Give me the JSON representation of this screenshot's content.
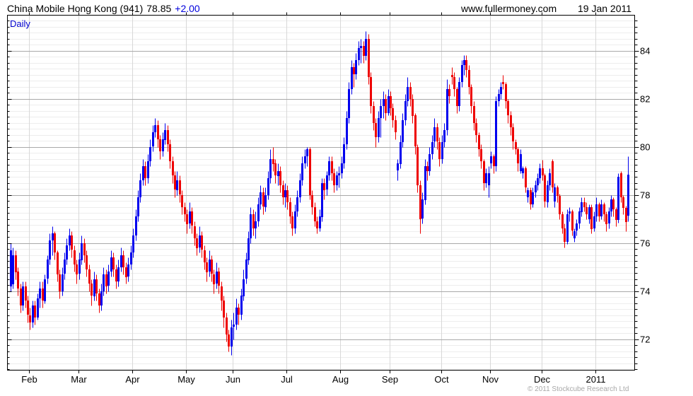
{
  "header": {
    "instrument": "China Mobile Hong Kong (941)",
    "price": "78.85",
    "change": "+2.00",
    "site": "www.fullermoney.com",
    "date": "19 Jan 2011"
  },
  "chart": {
    "interval_label": "Daily",
    "copyright": "© 2011 Stockcube Research Ltd",
    "colors": {
      "up": "#0000ee",
      "down": "#ee0000",
      "grid_minor": "#ededed",
      "grid_month": "#d8d8d8",
      "grid_major": "#a9a9a9",
      "border": "#000000",
      "accent_text": "#0000cc"
    }
  },
  "chart_data": {
    "type": "candlestick",
    "title": "China Mobile Hong Kong (941) Daily",
    "interval": "Daily",
    "last_price": 78.85,
    "change": 2.0,
    "ylim": [
      70.7,
      85.5
    ],
    "y_major_ticks": [
      72,
      74,
      76,
      78,
      80,
      82,
      84
    ],
    "y_minor_step": 0.25,
    "grid": true,
    "legend_position": "none",
    "x_ticks": [
      {
        "label": "Feb",
        "day": 8
      },
      {
        "label": "Mar",
        "day": 28
      },
      {
        "label": "Apr",
        "day": 50
      },
      {
        "label": "May",
        "day": 72
      },
      {
        "label": "Jun",
        "day": 91
      },
      {
        "label": "Jul",
        "day": 113
      },
      {
        "label": "Aug",
        "day": 135
      },
      {
        "label": "Sep",
        "day": 155
      },
      {
        "label": "Oct",
        "day": 176
      },
      {
        "label": "Nov",
        "day": 196
      },
      {
        "label": "Dec",
        "day": 217
      },
      {
        "label": "2011",
        "day": 239
      }
    ],
    "ohlc": [
      [
        74.2,
        76.0,
        74.0,
        75.7
      ],
      [
        74.3,
        75.8,
        74.1,
        75.5
      ],
      [
        75.5,
        75.7,
        74.5,
        74.8
      ],
      [
        74.8,
        75.0,
        73.8,
        74.1
      ],
      [
        74.1,
        74.3,
        73.1,
        73.4
      ],
      [
        73.4,
        74.4,
        73.2,
        74.2
      ],
      [
        74.2,
        74.4,
        73.3,
        73.6
      ],
      [
        73.6,
        73.8,
        72.7,
        73.0
      ],
      [
        73.0,
        73.3,
        72.4,
        72.7
      ],
      [
        72.7,
        73.6,
        72.5,
        73.4
      ],
      [
        73.4,
        73.6,
        72.6,
        72.9
      ],
      [
        72.9,
        73.9,
        72.8,
        73.7
      ],
      [
        73.7,
        74.4,
        73.3,
        74.1
      ],
      [
        74.1,
        74.4,
        73.3,
        73.6
      ],
      [
        73.6,
        74.7,
        73.5,
        74.5
      ],
      [
        74.5,
        75.5,
        74.3,
        75.3
      ],
      [
        75.3,
        76.4,
        75.1,
        76.1
      ],
      [
        76.1,
        76.7,
        75.5,
        76.4
      ],
      [
        76.4,
        76.5,
        75.3,
        75.6
      ],
      [
        75.6,
        75.7,
        74.4,
        74.7
      ],
      [
        74.7,
        74.9,
        73.7,
        74.0
      ],
      [
        74.0,
        75.0,
        73.8,
        74.7
      ],
      [
        74.7,
        75.6,
        74.5,
        75.3
      ],
      [
        75.3,
        76.2,
        75.1,
        75.9
      ],
      [
        75.9,
        76.6,
        75.7,
        76.3
      ],
      [
        76.3,
        76.5,
        75.4,
        75.7
      ],
      [
        75.7,
        75.9,
        74.8,
        75.1
      ],
      [
        75.1,
        75.3,
        74.3,
        74.7
      ],
      [
        74.7,
        75.6,
        74.5,
        75.3
      ],
      [
        75.3,
        76.3,
        75.1,
        76.0
      ],
      [
        76.0,
        76.2,
        75.2,
        75.5
      ],
      [
        75.5,
        75.7,
        74.6,
        74.9
      ],
      [
        74.9,
        75.1,
        74.0,
        74.3
      ],
      [
        74.3,
        74.5,
        73.4,
        73.8
      ],
      [
        73.8,
        74.8,
        73.6,
        74.5
      ],
      [
        74.5,
        74.7,
        73.6,
        73.9
      ],
      [
        73.9,
        74.1,
        73.1,
        73.4
      ],
      [
        73.4,
        74.3,
        73.2,
        74.0
      ],
      [
        74.0,
        75.0,
        73.8,
        74.7
      ],
      [
        74.7,
        74.9,
        73.9,
        74.2
      ],
      [
        74.2,
        75.1,
        74.0,
        74.8
      ],
      [
        74.8,
        75.7,
        74.6,
        75.4
      ],
      [
        75.4,
        75.6,
        74.6,
        74.9
      ],
      [
        74.9,
        75.1,
        74.1,
        74.4
      ],
      [
        74.4,
        75.3,
        74.2,
        75.0
      ],
      [
        75.0,
        75.8,
        74.8,
        75.5
      ],
      [
        75.5,
        75.7,
        74.7,
        75.0
      ],
      [
        75.0,
        75.2,
        74.3,
        74.6
      ],
      [
        74.6,
        75.4,
        74.4,
        75.1
      ],
      [
        75.1,
        75.9,
        74.9,
        75.6
      ],
      [
        75.6,
        76.6,
        75.4,
        76.3
      ],
      [
        76.3,
        77.4,
        76.1,
        77.1
      ],
      [
        77.1,
        78.2,
        76.9,
        77.9
      ],
      [
        77.9,
        78.9,
        77.7,
        78.6
      ],
      [
        78.6,
        79.5,
        78.4,
        79.2
      ],
      [
        79.2,
        79.4,
        78.4,
        78.7
      ],
      [
        78.7,
        79.7,
        78.5,
        79.4
      ],
      [
        79.4,
        80.3,
        79.2,
        80.0
      ],
      [
        80.0,
        80.9,
        79.8,
        80.6
      ],
      [
        80.6,
        81.2,
        80.4,
        80.9
      ],
      [
        80.9,
        81.1,
        80.0,
        80.3
      ],
      [
        80.3,
        80.5,
        79.5,
        79.8
      ],
      [
        79.8,
        80.6,
        79.6,
        80.3
      ],
      [
        80.3,
        81.0,
        80.1,
        80.7
      ],
      [
        80.7,
        80.9,
        79.8,
        80.1
      ],
      [
        80.1,
        80.3,
        79.1,
        79.4
      ],
      [
        79.4,
        79.6,
        78.5,
        78.8
      ],
      [
        78.8,
        79.0,
        77.9,
        78.2
      ],
      [
        78.2,
        79.0,
        78.0,
        78.6
      ],
      [
        78.6,
        78.8,
        77.7,
        78.0
      ],
      [
        78.0,
        78.2,
        77.2,
        77.5
      ],
      [
        77.5,
        77.7,
        76.9,
        77.2
      ],
      [
        77.2,
        77.4,
        76.4,
        76.8
      ],
      [
        76.8,
        77.7,
        76.6,
        77.3
      ],
      [
        77.3,
        77.5,
        76.4,
        76.7
      ],
      [
        76.7,
        76.9,
        75.9,
        76.2
      ],
      [
        76.2,
        76.4,
        75.5,
        75.8
      ],
      [
        75.8,
        76.7,
        75.6,
        76.3
      ],
      [
        76.3,
        76.5,
        75.4,
        75.7
      ],
      [
        75.7,
        75.9,
        74.9,
        75.2
      ],
      [
        75.2,
        75.4,
        74.4,
        74.8
      ],
      [
        74.8,
        75.7,
        74.6,
        75.3
      ],
      [
        75.3,
        75.5,
        74.4,
        74.7
      ],
      [
        74.7,
        74.9,
        73.9,
        74.3
      ],
      [
        74.3,
        75.2,
        74.1,
        74.8
      ],
      [
        74.8,
        75.0,
        73.9,
        74.2
      ],
      [
        74.2,
        74.4,
        73.2,
        73.6
      ],
      [
        73.6,
        73.8,
        72.5,
        72.9
      ],
      [
        72.9,
        73.1,
        71.9,
        72.2
      ],
      [
        72.2,
        72.4,
        71.5,
        71.7
      ],
      [
        71.7,
        72.8,
        71.35,
        72.5
      ],
      [
        72.5,
        73.1,
        72.0,
        72.6
      ],
      [
        72.6,
        73.7,
        72.4,
        73.3
      ],
      [
        73.3,
        73.5,
        72.6,
        73.0
      ],
      [
        73.0,
        74.1,
        72.8,
        73.8
      ],
      [
        73.8,
        74.9,
        73.6,
        74.5
      ],
      [
        74.5,
        75.6,
        74.3,
        75.3
      ],
      [
        75.3,
        76.5,
        75.1,
        76.2
      ],
      [
        76.2,
        77.5,
        76.0,
        77.2
      ],
      [
        77.2,
        77.4,
        76.3,
        76.6
      ],
      [
        76.6,
        77.3,
        76.2,
        76.9
      ],
      [
        76.9,
        77.9,
        76.7,
        77.6
      ],
      [
        77.6,
        78.4,
        77.4,
        78.1
      ],
      [
        78.1,
        78.3,
        77.2,
        77.5
      ],
      [
        77.5,
        78.3,
        77.3,
        78.0
      ],
      [
        78.0,
        79.0,
        77.8,
        78.7
      ],
      [
        78.7,
        79.9,
        78.5,
        79.5
      ],
      [
        79.5,
        80.0,
        79.0,
        79.3
      ],
      [
        79.3,
        79.5,
        78.5,
        78.8
      ],
      [
        78.8,
        79.3,
        78.4,
        79.0
      ],
      [
        79.0,
        79.2,
        78.1,
        78.4
      ],
      [
        78.4,
        78.6,
        77.6,
        77.9
      ],
      [
        77.9,
        78.5,
        77.5,
        78.2
      ],
      [
        78.2,
        78.4,
        77.4,
        77.7
      ],
      [
        77.7,
        77.9,
        76.8,
        77.1
      ],
      [
        77.1,
        77.3,
        76.3,
        76.6
      ],
      [
        76.6,
        77.6,
        76.4,
        77.3
      ],
      [
        77.3,
        78.2,
        77.1,
        77.9
      ],
      [
        77.9,
        78.9,
        77.7,
        78.6
      ],
      [
        78.6,
        79.6,
        78.4,
        79.3
      ],
      [
        79.3,
        79.9,
        79.1,
        79.6
      ],
      [
        79.6,
        80.0,
        79.2,
        79.9
      ],
      [
        79.9,
        80.0,
        77.8,
        78.0
      ],
      [
        78.0,
        78.2,
        77.2,
        77.5
      ],
      [
        77.5,
        77.7,
        76.7,
        76.9
      ],
      [
        76.9,
        77.1,
        76.4,
        76.6
      ],
      [
        76.6,
        77.4,
        76.5,
        77.1
      ],
      [
        77.1,
        78.7,
        76.9,
        78.5
      ],
      [
        78.5,
        78.7,
        77.8,
        78.2
      ],
      [
        78.2,
        79.0,
        78.0,
        78.8
      ],
      [
        78.8,
        79.6,
        78.6,
        79.4
      ],
      [
        79.4,
        79.6,
        78.6,
        78.9
      ],
      [
        78.9,
        79.1,
        78.1,
        78.4
      ],
      [
        78.4,
        79.0,
        78.2,
        78.8
      ],
      [
        78.8,
        79.2,
        78.3,
        78.9
      ],
      [
        78.9,
        79.6,
        78.7,
        79.3
      ],
      [
        79.3,
        80.4,
        79.1,
        80.1
      ],
      [
        80.1,
        81.5,
        79.9,
        81.2
      ],
      [
        81.2,
        82.7,
        81.0,
        82.4
      ],
      [
        82.4,
        83.6,
        82.2,
        83.3
      ],
      [
        83.3,
        83.5,
        82.5,
        83.0
      ],
      [
        83.0,
        83.9,
        82.8,
        83.6
      ],
      [
        83.6,
        84.4,
        83.4,
        84.1
      ],
      [
        84.1,
        84.5,
        83.5,
        84.2
      ],
      [
        84.2,
        84.4,
        83.5,
        83.8
      ],
      [
        83.8,
        84.8,
        83.6,
        84.5
      ],
      [
        84.5,
        84.7,
        82.6,
        82.9
      ],
      [
        82.9,
        83.1,
        81.4,
        81.7
      ],
      [
        81.7,
        81.9,
        80.7,
        81.0
      ],
      [
        81.0,
        81.2,
        80.0,
        80.4
      ],
      [
        80.4,
        81.5,
        80.2,
        81.2
      ],
      [
        81.2,
        82.0,
        80.4,
        81.7
      ],
      [
        81.7,
        82.3,
        81.2,
        82.0
      ],
      [
        82.0,
        82.2,
        81.1,
        81.4
      ],
      [
        81.4,
        82.4,
        81.3,
        82.1
      ],
      [
        82.1,
        82.3,
        81.3,
        81.6
      ],
      [
        81.6,
        81.8,
        80.8,
        81.1
      ],
      [
        81.1,
        81.3,
        80.3,
        80.6
      ],
      [
        79.0,
        79.5,
        78.6,
        79.3
      ],
      [
        79.3,
        80.5,
        79.1,
        80.2
      ],
      [
        80.2,
        81.4,
        80.0,
        81.1
      ],
      [
        81.1,
        82.2,
        80.9,
        81.9
      ],
      [
        81.9,
        82.9,
        81.7,
        82.5
      ],
      [
        82.5,
        82.7,
        81.7,
        82.0
      ],
      [
        82.0,
        82.2,
        81.0,
        81.3
      ],
      [
        81.3,
        81.4,
        79.7,
        80.0
      ],
      [
        80.0,
        80.1,
        78.1,
        78.4
      ],
      [
        78.4,
        78.6,
        76.4,
        77.0
      ],
      [
        77.0,
        78.1,
        76.8,
        77.8
      ],
      [
        77.8,
        79.5,
        77.6,
        79.2
      ],
      [
        79.2,
        79.4,
        78.6,
        79.0
      ],
      [
        79.0,
        80.0,
        78.8,
        79.7
      ],
      [
        79.7,
        80.5,
        79.5,
        80.2
      ],
      [
        80.2,
        81.2,
        80.0,
        80.8
      ],
      [
        80.8,
        81.0,
        79.9,
        80.2
      ],
      [
        80.2,
        80.4,
        79.2,
        79.5
      ],
      [
        79.5,
        80.5,
        79.3,
        80.2
      ],
      [
        80.2,
        81.0,
        80.0,
        80.7
      ],
      [
        80.7,
        82.8,
        80.5,
        82.4
      ],
      [
        82.4,
        82.6,
        81.8,
        82.1
      ],
      [
        83.0,
        83.3,
        82.6,
        82.9
      ],
      [
        82.9,
        83.1,
        82.1,
        82.4
      ],
      [
        82.4,
        82.5,
        81.4,
        81.7
      ],
      [
        81.7,
        82.9,
        81.5,
        82.7
      ],
      [
        82.7,
        83.6,
        82.5,
        83.4
      ],
      [
        83.4,
        83.8,
        83.0,
        83.6
      ],
      [
        83.6,
        83.8,
        82.9,
        83.2
      ],
      [
        83.2,
        83.4,
        82.2,
        82.5
      ],
      [
        82.5,
        82.6,
        81.4,
        81.7
      ],
      [
        81.7,
        81.9,
        80.7,
        81.0
      ],
      [
        81.0,
        81.2,
        80.2,
        80.5
      ],
      [
        80.5,
        80.6,
        79.6,
        79.9
      ],
      [
        79.9,
        80.1,
        79.1,
        79.4
      ],
      [
        79.4,
        79.5,
        78.2,
        78.5
      ],
      [
        78.5,
        79.1,
        78.3,
        78.9
      ],
      [
        78.4,
        79.2,
        77.9,
        78.9
      ],
      [
        79.3,
        79.8,
        79.1,
        79.6
      ],
      [
        79.6,
        79.7,
        78.9,
        79.2
      ],
      [
        79.2,
        82.1,
        79.0,
        81.9
      ],
      [
        81.9,
        82.4,
        81.7,
        82.2
      ],
      [
        82.2,
        82.7,
        82.0,
        82.5
      ],
      [
        82.7,
        83.0,
        82.4,
        82.6
      ],
      [
        82.6,
        82.7,
        81.6,
        81.9
      ],
      [
        81.9,
        82.0,
        81.0,
        81.3
      ],
      [
        81.3,
        81.5,
        80.5,
        80.8
      ],
      [
        80.8,
        81.0,
        79.9,
        80.2
      ],
      [
        80.2,
        80.3,
        79.7,
        79.9
      ],
      [
        79.9,
        80.0,
        79.0,
        79.3
      ],
      [
        79.0,
        79.9,
        78.9,
        79.7
      ],
      [
        78.9,
        79.2,
        78.7,
        79.1
      ],
      [
        79.1,
        79.2,
        78.1,
        78.3
      ],
      [
        77.9,
        78.3,
        77.7,
        78.2
      ],
      [
        78.2,
        78.3,
        77.4,
        77.6
      ],
      [
        77.6,
        78.3,
        77.5,
        78.1
      ],
      [
        78.1,
        78.6,
        77.9,
        78.4
      ],
      [
        78.4,
        78.9,
        78.2,
        78.7
      ],
      [
        78.7,
        79.3,
        78.5,
        79.1
      ],
      [
        79.1,
        79.45,
        78.6,
        78.8
      ],
      [
        78.8,
        78.9,
        77.5,
        77.7
      ],
      [
        77.7,
        78.6,
        77.5,
        78.4
      ],
      [
        78.4,
        79.1,
        78.2,
        78.9
      ],
      [
        79.4,
        79.5,
        78.1,
        78.3
      ],
      [
        77.7,
        78.5,
        77.5,
        78.3
      ],
      [
        78.3,
        78.4,
        77.7,
        77.95
      ],
      [
        77.95,
        78.05,
        77.0,
        77.2
      ],
      [
        77.2,
        77.3,
        76.4,
        76.6
      ],
      [
        76.6,
        76.8,
        75.8,
        76.05
      ],
      [
        76.05,
        77.4,
        75.95,
        77.2
      ],
      [
        77.2,
        77.5,
        76.9,
        77.3
      ],
      [
        77.3,
        77.4,
        76.3,
        76.5
      ],
      [
        76.2,
        76.6,
        76.05,
        76.5
      ],
      [
        76.5,
        77.0,
        76.3,
        76.8
      ],
      [
        76.8,
        77.5,
        76.6,
        77.3
      ],
      [
        77.3,
        77.9,
        77.1,
        77.7
      ],
      [
        77.7,
        77.9,
        77.3,
        77.5
      ],
      [
        77.5,
        77.7,
        77.0,
        77.2
      ],
      [
        77.0,
        77.6,
        76.8,
        77.5
      ],
      [
        77.5,
        77.6,
        76.4,
        76.6
      ],
      [
        76.6,
        77.3,
        76.5,
        77.1
      ],
      [
        77.1,
        77.9,
        76.9,
        77.6
      ],
      [
        77.6,
        77.7,
        76.9,
        77.1
      ],
      [
        77.1,
        77.8,
        77.0,
        77.6
      ],
      [
        77.6,
        77.7,
        76.9,
        77.2
      ],
      [
        77.2,
        77.3,
        76.5,
        76.8
      ],
      [
        76.8,
        77.5,
        76.6,
        77.3
      ],
      [
        77.3,
        78.0,
        77.1,
        77.8
      ],
      [
        77.8,
        77.9,
        77.1,
        77.4
      ],
      [
        77.4,
        77.5,
        76.7,
        76.95
      ],
      [
        76.95,
        78.9,
        76.85,
        78.75
      ],
      [
        78.9,
        79.0,
        77.7,
        77.9
      ],
      [
        77.9,
        78.0,
        77.2,
        77.45
      ],
      [
        77.45,
        77.55,
        76.5,
        76.85
      ],
      [
        77.15,
        79.6,
        76.9,
        78.85
      ]
    ]
  }
}
